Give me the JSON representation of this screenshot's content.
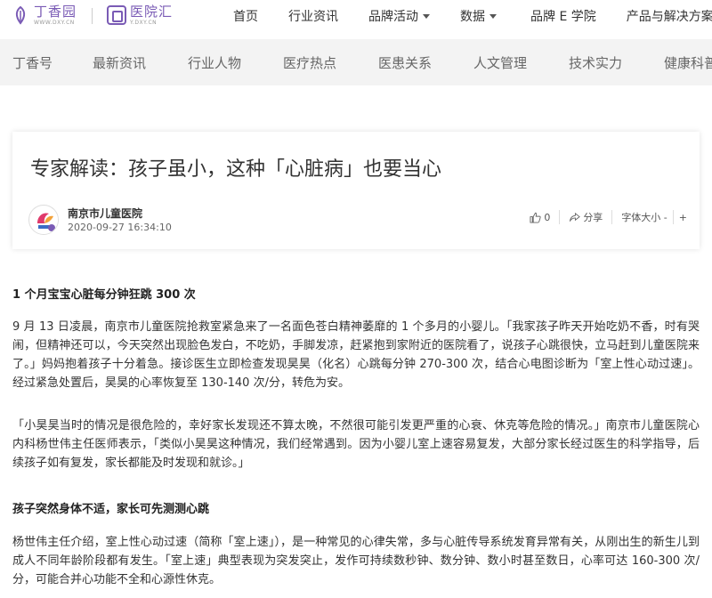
{
  "header": {
    "logo1": {
      "cn": "丁香园",
      "en": "WWW.DXY.CN"
    },
    "logo2": {
      "cn": "医院汇",
      "en": "Y.DXY.CN"
    },
    "nav": [
      {
        "label": "首页",
        "dropdown": false
      },
      {
        "label": "行业资讯",
        "dropdown": false
      },
      {
        "label": "品牌活动",
        "dropdown": true
      },
      {
        "label": "数据",
        "dropdown": true
      },
      {
        "label": "品牌 E 学院",
        "dropdown": false
      },
      {
        "label": "产品与解决方案",
        "dropdown": false
      }
    ]
  },
  "categories": [
    "丁香号",
    "最新资讯",
    "行业人物",
    "医疗热点",
    "医患关系",
    "人文管理",
    "技术实力",
    "健康科普"
  ],
  "article": {
    "title": "专家解读：孩子虽小，这种「心脏病」也要当心",
    "author": "南京市儿童医院",
    "date": "2020-09-27 16:34:10",
    "likes": "0",
    "share_label": "分享",
    "font_size_label": "字体大小 -",
    "font_plus": "+"
  },
  "body": {
    "h1": "1 个月宝宝心脏每分钟狂跳 300 次",
    "p1": "9 月 13 日凌晨，南京市儿童医院抢救室紧急来了一名面色苍白精神萎靡的 1 个多月的小婴儿。「我家孩子昨天开始吃奶不香，时有哭闹，但精神还可以，今天突然出现脸色发白，不吃奶，手脚发凉，赶紧抱到家附近的医院看了，说孩子心跳很快，立马赶到儿童医院来了。」妈妈抱着孩子十分着急。接诊医生立即检查发现昊昊（化名）心跳每分钟 270-300 次，结合心电图诊断为「室上性心动过速」。经过紧急处置后，昊昊的心率恢复至 130-140 次/分，转危为安。",
    "p2": "「小昊昊当时的情况是很危险的，幸好家长发现还不算太晚，不然很可能引发更严重的心衰、休克等危险的情况。」南京市儿童医院心内科杨世伟主任医师表示，「类似小昊昊这种情况，我们经常遇到。因为小婴儿室上速容易复发，大部分家长经过医生的科学指导，后续孩子如有复发，家长都能及时发现和就诊。」",
    "h2": "孩子突然身体不适，家长可先测测心跳",
    "p3": "杨世伟主任介绍，室上性心动过速（简称「室上速」），是一种常见的心律失常，多与心脏传导系统发育异常有关，从刚出生的新生儿到成人不同年龄阶段都有发生。「室上速」典型表现为突发突止，发作可持续数秒钟、数分钟、数小时甚至数日，心率可达 160-300 次/分，可能合并心功能不全和心源性休克。"
  },
  "colors": {
    "brand": "#7a5bb5",
    "catbar_bg": "#f3f3f3"
  }
}
